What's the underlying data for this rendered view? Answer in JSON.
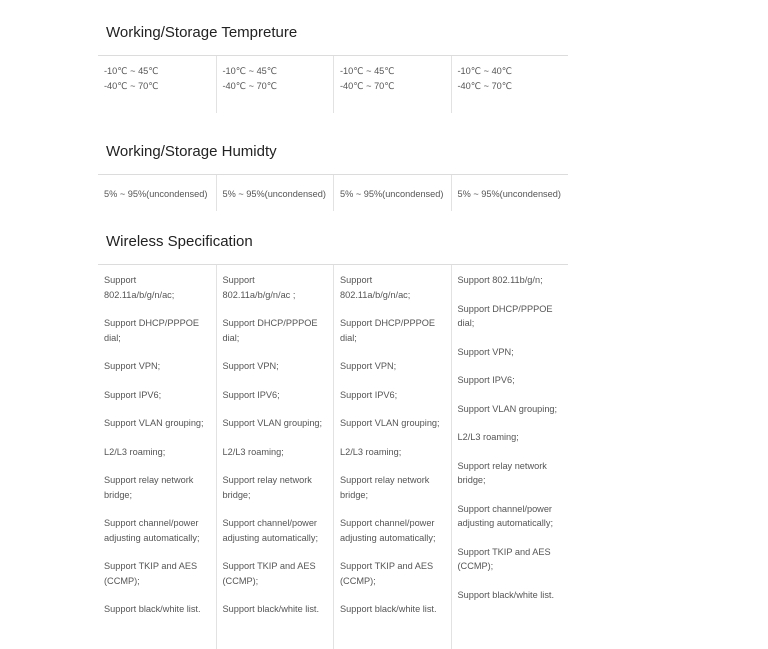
{
  "temperature": {
    "title": "Working/Storage Tempreture",
    "columns": [
      {
        "working": "-10℃ ~ 45℃",
        "storage": "-40℃ ~ 70℃"
      },
      {
        "working": "-10℃ ~ 45℃",
        "storage": "-40℃ ~ 70℃"
      },
      {
        "working": "-10℃ ~ 45℃",
        "storage": "-40℃ ~ 70℃"
      },
      {
        "working": "-10℃ ~ 40℃",
        "storage": "-40℃ ~ 70℃"
      }
    ]
  },
  "humidity": {
    "title": "Working/Storage Humidty",
    "columns": [
      "5% ~ 95%(uncondensed)",
      "5% ~ 95%(uncondensed)",
      "5% ~ 95%(uncondensed)",
      "5% ~ 95%(uncondensed)"
    ]
  },
  "wireless": {
    "title": "Wireless Specification",
    "columns": [
      {
        "items": [
          [
            "Support",
            "802.11a/b/g/n/ac;"
          ],
          [
            "Support DHCP/PPPOE",
            "dial;"
          ],
          [
            "Support VPN;"
          ],
          [
            "Support IPV6;"
          ],
          [
            "Support VLAN grouping;"
          ],
          [
            "L2/L3 roaming;"
          ],
          [
            "Support relay network",
            "bridge;"
          ],
          [
            "Support channel/power",
            "adjusting automatically;"
          ],
          [
            "Support TKIP and AES",
            "(CCMP);"
          ],
          [
            "Support black/white list."
          ]
        ]
      },
      {
        "items": [
          [
            "Support",
            "802.11a/b/g/n/ac ;"
          ],
          [
            "Support DHCP/PPPOE",
            "dial;"
          ],
          [
            "Support VPN;"
          ],
          [
            "Support IPV6;"
          ],
          [
            "Support VLAN grouping;"
          ],
          [
            "L2/L3 roaming;"
          ],
          [
            "Support relay network",
            "bridge;"
          ],
          [
            "Support channel/power",
            "adjusting automatically;"
          ],
          [
            "Support TKIP and AES",
            "(CCMP);"
          ],
          [
            "Support black/white list."
          ]
        ]
      },
      {
        "items": [
          [
            "Support",
            "802.11a/b/g/n/ac;"
          ],
          [
            "Support DHCP/PPPOE",
            "dial;"
          ],
          [
            "Support VPN;"
          ],
          [
            "Support IPV6;"
          ],
          [
            "Support VLAN grouping;"
          ],
          [
            "L2/L3 roaming;"
          ],
          [
            "Support relay network",
            "bridge;"
          ],
          [
            "Support channel/power",
            "adjusting automatically;"
          ],
          [
            "Support TKIP and AES",
            "(CCMP);"
          ],
          [
            "Support black/white list."
          ]
        ]
      },
      {
        "items": [
          [
            "Support 802.11b/g/n;"
          ],
          [
            "Support DHCP/PPPOE",
            "dial;"
          ],
          [
            "Support VPN;"
          ],
          [
            "Support IPV6;"
          ],
          [
            "Support VLAN grouping;"
          ],
          [
            "L2/L3 roaming;"
          ],
          [
            "Support relay network",
            "bridge;"
          ],
          [
            "Support channel/power",
            "adjusting automatically;"
          ],
          [
            "Support TKIP and AES",
            "(CCMP);"
          ],
          [
            "Support black/white list."
          ]
        ]
      }
    ]
  }
}
